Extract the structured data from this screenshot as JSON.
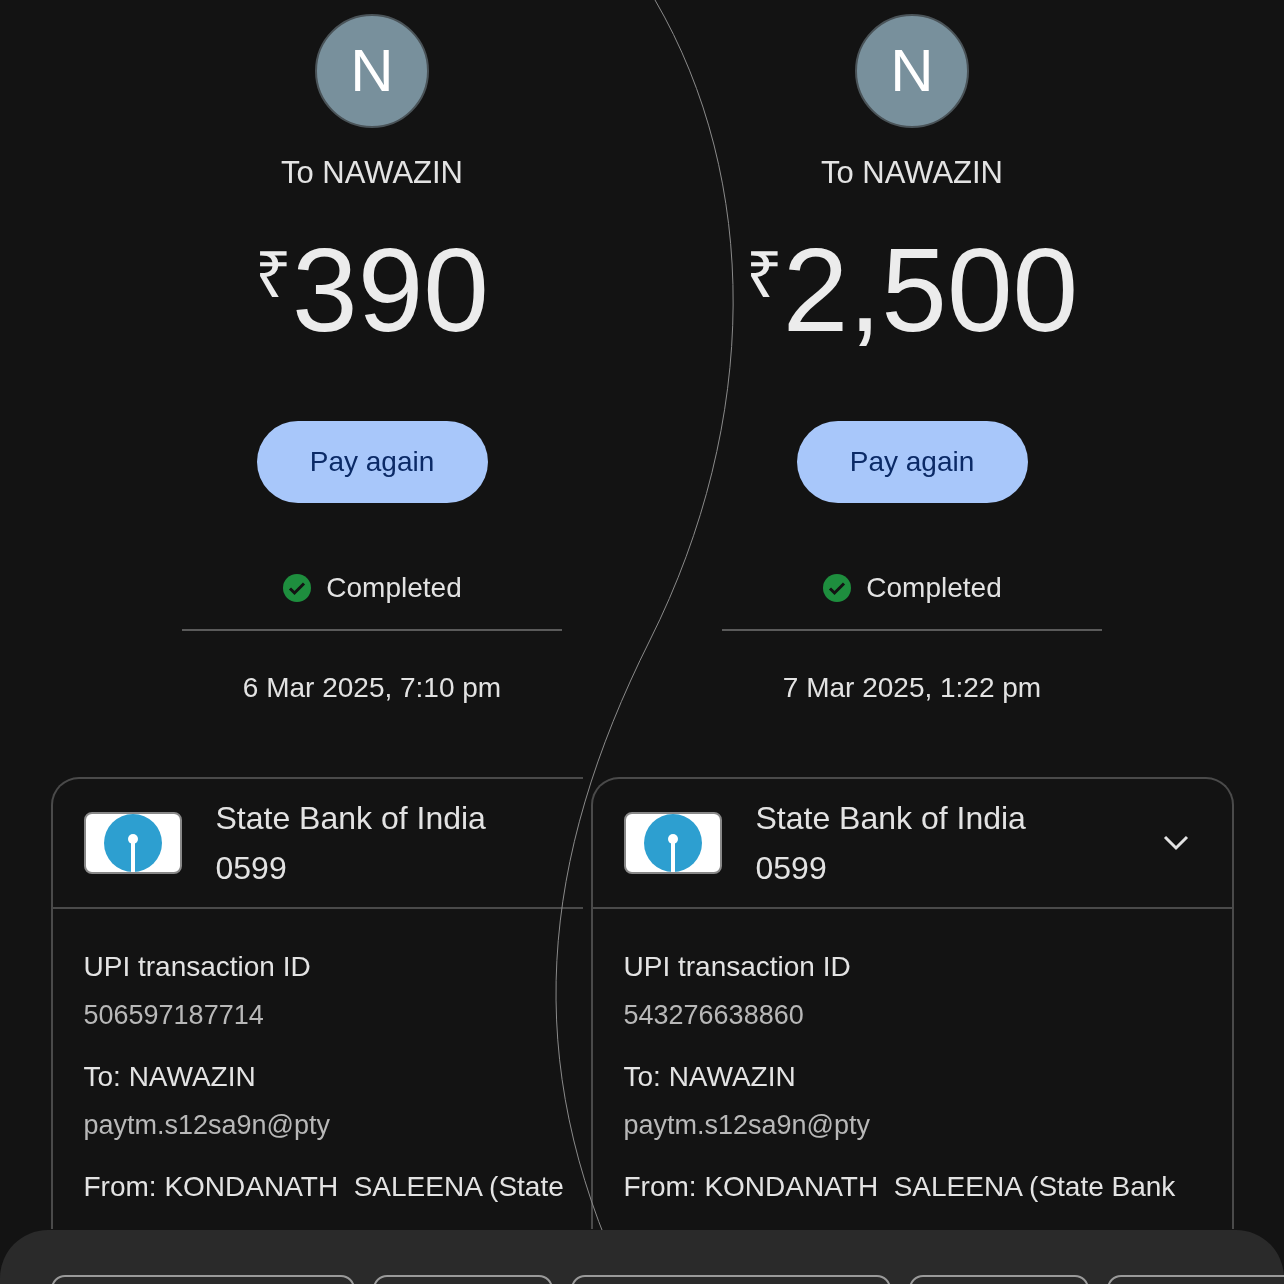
{
  "panels": [
    {
      "avatar_initial": "N",
      "recipient": "To NAWAZIN",
      "currency": "₹",
      "amount": "390",
      "button": "Pay again",
      "status": "Completed",
      "date": "6 Mar 2025, 7:10 pm",
      "bank": {
        "name": "State Bank of India",
        "account": "0599"
      },
      "details": [
        {
          "label": "UPI transaction ID",
          "value": "506597187714"
        },
        {
          "label": "To: NAWAZIN",
          "value": "paytm.s12sa9n@pty"
        },
        {
          "label": "From: KONDANATH  SALEENA (State"
        }
      ]
    },
    {
      "avatar_initial": "N",
      "recipient": "To NAWAZIN",
      "currency": "₹",
      "amount": "2,500",
      "button": "Pay again",
      "status": "Completed",
      "date": "7 Mar 2025, 1:22 pm",
      "bank": {
        "name": "State Bank of India",
        "account": "0599",
        "chevron": true
      },
      "details": [
        {
          "label": "UPI transaction ID",
          "value": "543276638860"
        },
        {
          "label": "To: NAWAZIN",
          "value": "paytm.s12sa9n@pty"
        },
        {
          "label": "From: KONDANATH  SALEENA (State Bank"
        }
      ]
    }
  ]
}
